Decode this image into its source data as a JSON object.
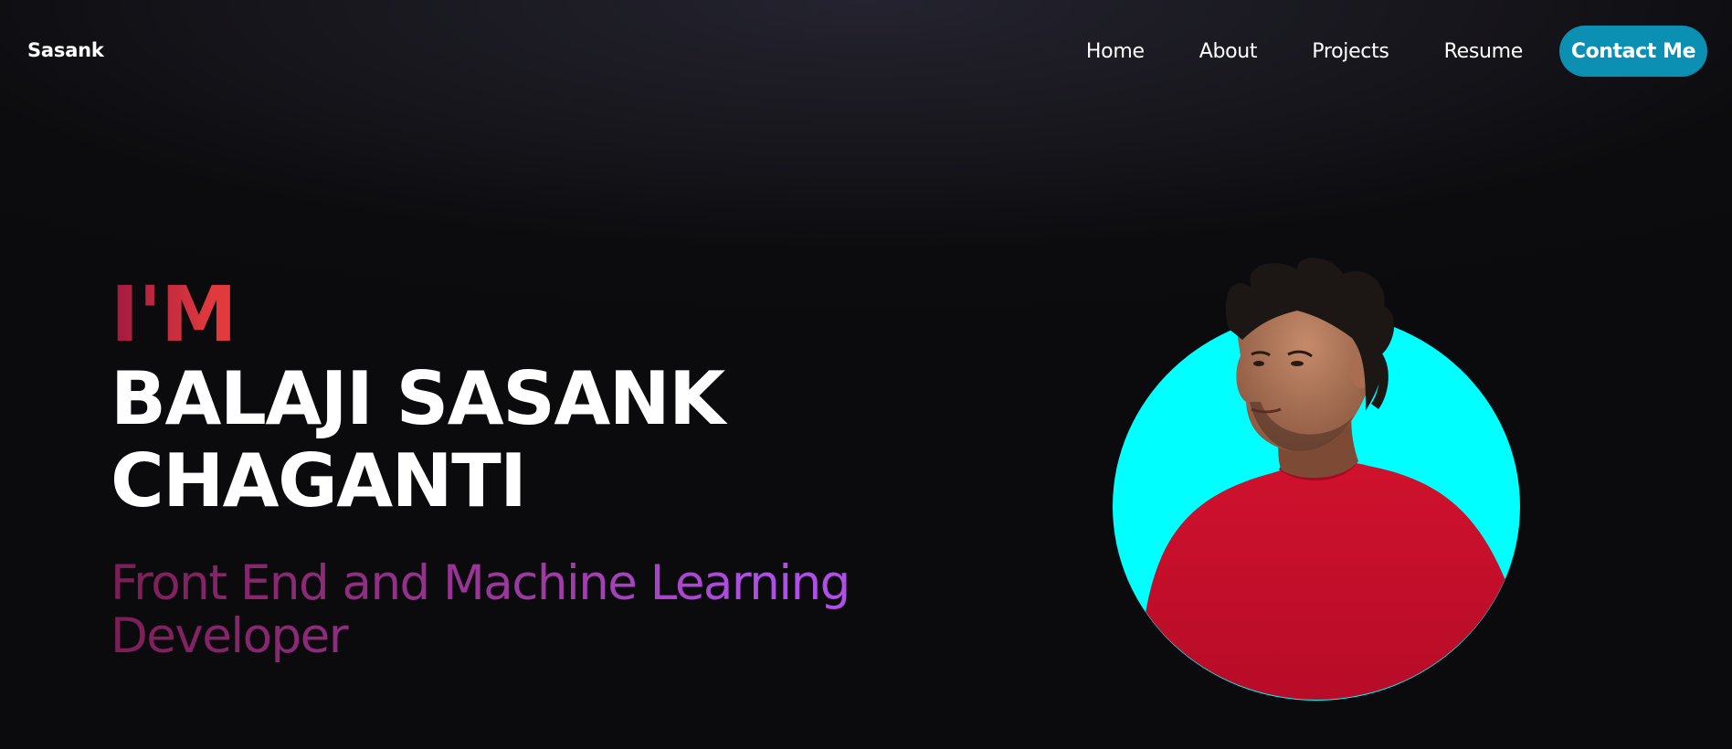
{
  "nav": {
    "brand": "Sasank",
    "links": [
      "Home",
      "About",
      "Projects",
      "Resume"
    ],
    "contact_label": "Contact Me"
  },
  "hero": {
    "intro": "I'M",
    "name_line1": "BALAJI SASANK",
    "name_line2": "CHAGANTI",
    "role": "Front End and Machine Learning Developer"
  },
  "colors": {
    "background": "#0b0b0d",
    "accent_button": "#0b8fb3",
    "portrait_circle": "#00ffff",
    "intro_gradient": [
      "#a0193f",
      "#e03a3e"
    ],
    "role_gradient": [
      "#7d1d54",
      "#b04ee8"
    ],
    "shirt": "#c8102e"
  },
  "portrait": {
    "subject": "profile-photo"
  }
}
